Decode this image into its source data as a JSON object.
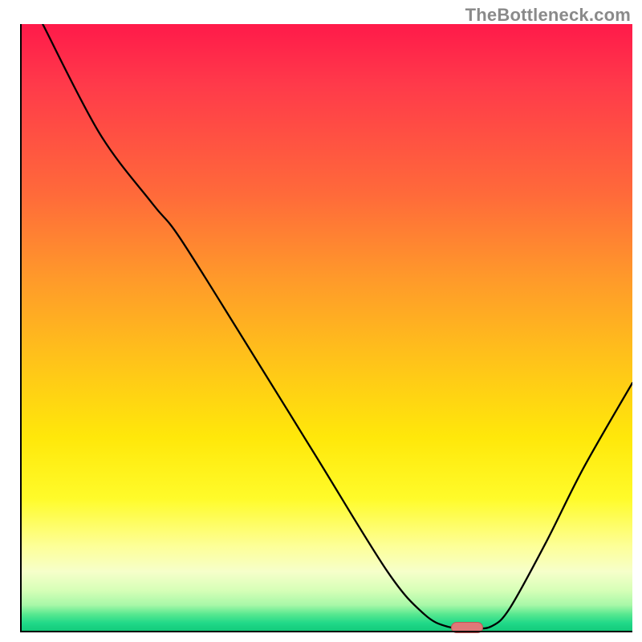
{
  "watermark": "TheBottleneck.com",
  "chart_data": {
    "type": "line",
    "title": "",
    "xlabel": "",
    "ylabel": "",
    "xlim": [
      0,
      100
    ],
    "ylim": [
      0,
      100
    ],
    "curve_points": [
      {
        "x": 3.7,
        "y": 100
      },
      {
        "x": 13,
        "y": 82
      },
      {
        "x": 21.6,
        "y": 70.5
      },
      {
        "x": 26,
        "y": 65
      },
      {
        "x": 36,
        "y": 49
      },
      {
        "x": 48,
        "y": 29.5
      },
      {
        "x": 60,
        "y": 10
      },
      {
        "x": 66,
        "y": 3
      },
      {
        "x": 70,
        "y": 0.9
      },
      {
        "x": 74,
        "y": 0.7
      },
      {
        "x": 77,
        "y": 1.0
      },
      {
        "x": 80,
        "y": 4
      },
      {
        "x": 86,
        "y": 15
      },
      {
        "x": 92,
        "y": 27
      },
      {
        "x": 100,
        "y": 41
      }
    ],
    "marker": {
      "x": 73,
      "y": 0.8,
      "label": ""
    },
    "grid": false,
    "legend": null
  }
}
